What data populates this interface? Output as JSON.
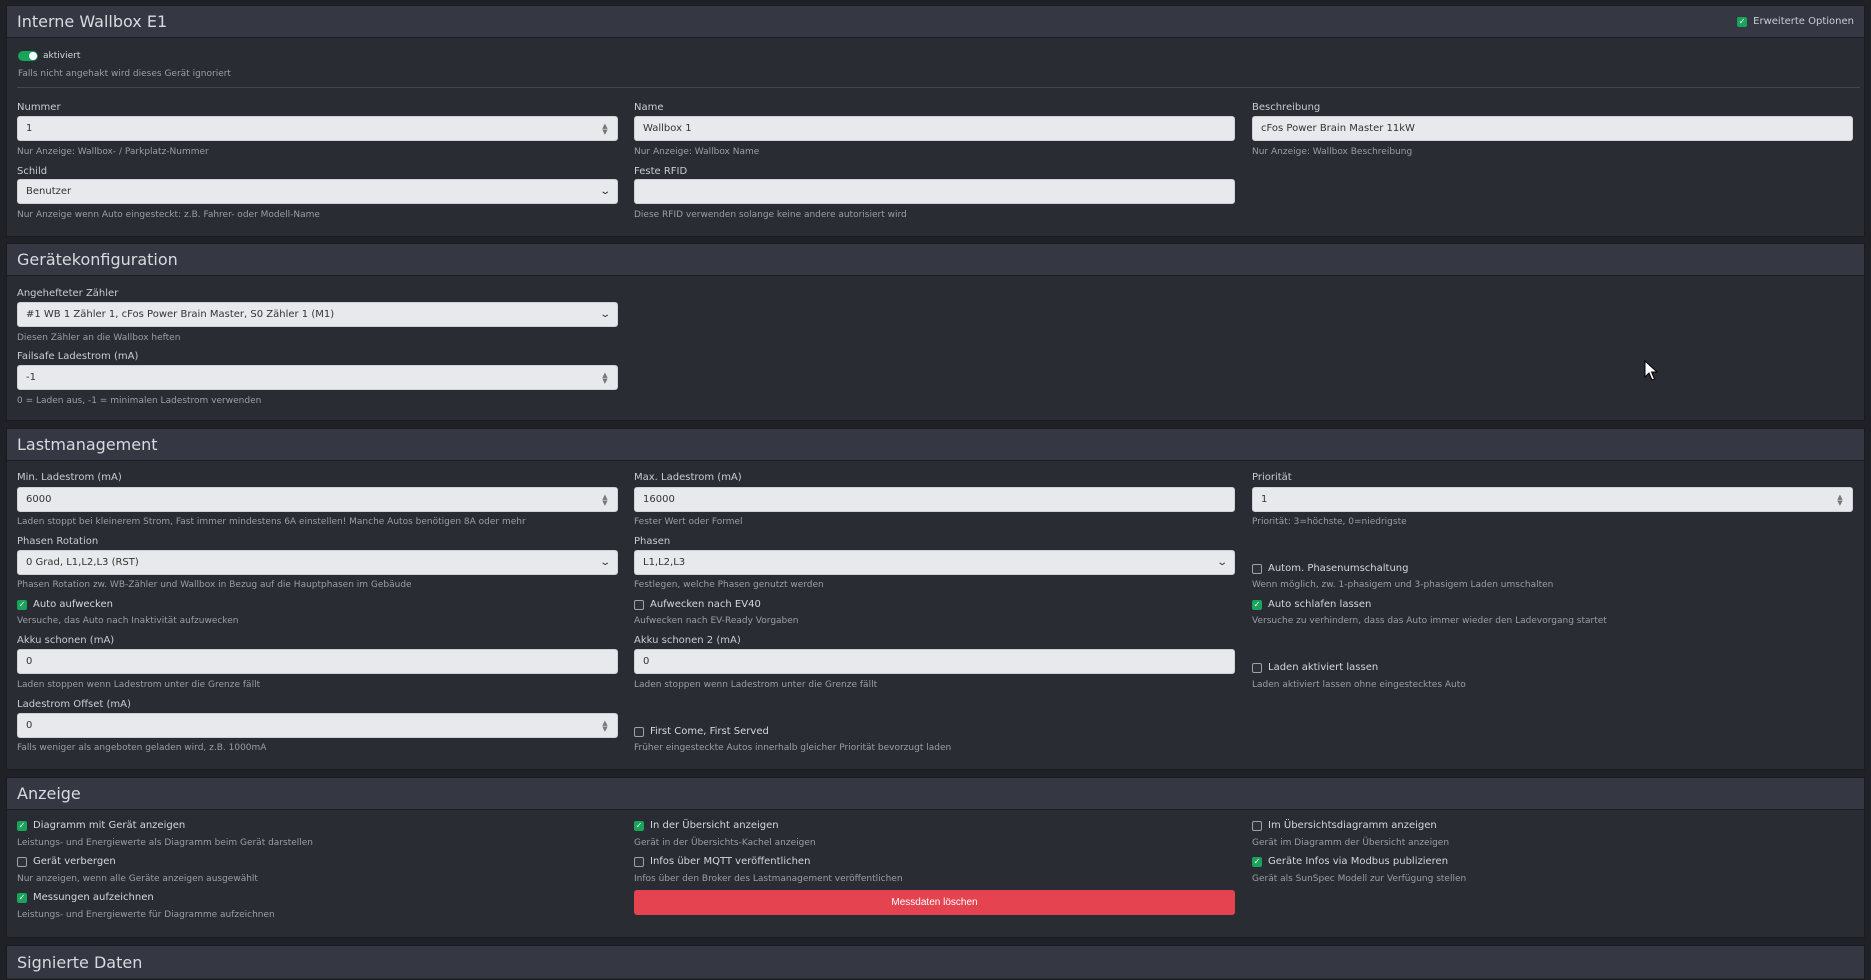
{
  "wallbox": {
    "title": "Interne Wallbox E1",
    "advanced_label": "Erweiterte Optionen",
    "advanced_checked": true,
    "enabled_label": "aktiviert",
    "enabled_help": "Falls nicht angehakt wird dieses Gerät ignoriert",
    "number": {
      "label": "Nummer",
      "value": "1",
      "help": "Nur Anzeige: Wallbox- / Parkplatz-Nummer"
    },
    "name": {
      "label": "Name",
      "value": "Wallbox 1",
      "help": "Nur Anzeige: Wallbox Name"
    },
    "description": {
      "label": "Beschreibung",
      "value": "cFos Power Brain Master 11kW",
      "help": "Nur Anzeige: Wallbox Beschreibung"
    },
    "sign": {
      "label": "Schild",
      "value": "Benutzer",
      "help": "Nur Anzeige wenn Auto eingesteckt: z.B. Fahrer- oder Modell-Name"
    },
    "rfid": {
      "label": "Feste RFID",
      "value": "",
      "help": "Diese RFID verwenden solange keine andere autorisiert wird"
    }
  },
  "device_config": {
    "title": "Gerätekonfiguration",
    "meter": {
      "label": "Angehefteter Zähler",
      "value": "#1 WB 1 Zähler 1, cFos Power Brain Master, S0 Zähler 1 (M1)",
      "help": "Diesen Zähler an die Wallbox heften"
    },
    "failsafe": {
      "label": "Failsafe Ladestrom (mA)",
      "value": "-1",
      "help": "0 = Laden aus, -1 = minimalen Ladestrom verwenden"
    }
  },
  "load_mgmt": {
    "title": "Lastmanagement",
    "min_current": {
      "label": "Min. Ladestrom (mA)",
      "value": "6000",
      "help": "Laden stoppt bei kleinerem Strom, Fast immer mindestens 6A einstellen! Manche Autos benötigen 8A oder mehr"
    },
    "max_current": {
      "label": "Max. Ladestrom (mA)",
      "value": "16000",
      "help": "Fester Wert oder Formel"
    },
    "priority": {
      "label": "Priorität",
      "value": "1",
      "help": "Priorität: 3=höchste, 0=niedrigste"
    },
    "phase_rotation": {
      "label": "Phasen Rotation",
      "value": "0 Grad, L1,L2,L3 (RST)",
      "help": "Phasen Rotation zw. WB-Zähler und Wallbox in Bezug auf die Hauptphasen im Gebäude"
    },
    "phases": {
      "label": "Phasen",
      "value": "L1,L2,L3",
      "help": "Festlegen, welche Phasen genutzt werden"
    },
    "auto_phase": {
      "label": "Autom. Phasenumschaltung",
      "checked": false,
      "help": "Wenn möglich, zw. 1-phasigem und 3-phasigem Laden umschalten"
    },
    "wake_car": {
      "label": "Auto aufwecken",
      "checked": true,
      "help": "Versuche, das Auto nach Inaktivität aufzuwecken"
    },
    "wake_ev40": {
      "label": "Aufwecken nach EV40",
      "checked": false,
      "help": "Aufwecken nach EV-Ready Vorgaben"
    },
    "let_sleep": {
      "label": "Auto schlafen lassen",
      "checked": true,
      "help": "Versuche zu verhindern, dass das Auto immer wieder den Ladevorgang startet"
    },
    "battery_save": {
      "label": "Akku schonen (mA)",
      "value": "0",
      "help": "Laden stoppen wenn Ladestrom unter die Grenze fällt"
    },
    "battery_save2": {
      "label": "Akku schonen 2 (mA)",
      "value": "0",
      "help": "Laden stoppen wenn Ladestrom unter die Grenze fällt"
    },
    "keep_enabled": {
      "label": "Laden aktiviert lassen",
      "checked": false,
      "help": "Laden aktiviert lassen ohne eingestecktes Auto"
    },
    "offset": {
      "label": "Ladestrom Offset (mA)",
      "value": "0",
      "help": "Falls weniger als angeboten geladen wird, z.B. 1000mA"
    },
    "fcfs": {
      "label": "First Come, First Served",
      "checked": false,
      "help": "Früher eingesteckte Autos innerhalb gleicher Priorität bevorzugt laden"
    }
  },
  "display": {
    "title": "Anzeige",
    "show_chart": {
      "label": "Diagramm mit Gerät anzeigen",
      "checked": true,
      "help": "Leistungs- und Energiewerte als Diagramm beim Gerät darstellen"
    },
    "show_overview": {
      "label": "In der Übersicht anzeigen",
      "checked": true,
      "help": "Gerät in der Übersichts-Kachel anzeigen"
    },
    "show_overview_chart": {
      "label": "Im Übersichtsdiagramm anzeigen",
      "checked": false,
      "help": "Gerät im Diagramm der Übersicht anzeigen"
    },
    "hide_device": {
      "label": "Gerät verbergen",
      "checked": false,
      "help": "Nur anzeigen, wenn alle Geräte anzeigen ausgewählt"
    },
    "mqtt": {
      "label": "Infos über MQTT veröffentlichen",
      "checked": false,
      "help": "Infos über den Broker des Lastmanagement veröffentlichen"
    },
    "modbus": {
      "label": "Geräte Infos via Modbus publizieren",
      "checked": true,
      "help": "Gerät als SunSpec Modell zur Verfügung stellen"
    },
    "record": {
      "label": "Messungen aufzeichnen",
      "checked": true,
      "help": "Leistungs- und Energiewerte für Diagramme aufzeichnen"
    },
    "delete_button": "Messdaten löschen"
  },
  "signed": {
    "title": "Signierte Daten"
  },
  "colors": {
    "accent_green": "#19a35b",
    "danger": "#e4434f",
    "panel": "#2a2c33",
    "header": "#353842"
  }
}
